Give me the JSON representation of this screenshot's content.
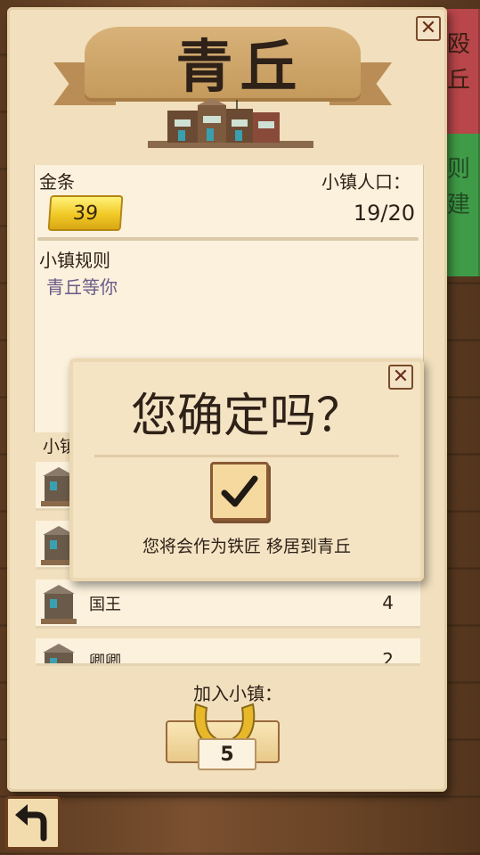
{
  "side_tabs": [
    {
      "label": "殴\n丘",
      "color": "#b8464a"
    },
    {
      "label": "则\n建",
      "color": "#3f9b47"
    }
  ],
  "town": {
    "name": "青丘",
    "gold_label": "金条",
    "gold_value": "39",
    "population_label": "小镇人口：",
    "population_value": "19/20",
    "rules_label": "小镇规则",
    "rules_text": "青丘等你",
    "list_header": "小镇"
  },
  "residents": [
    {
      "name": "",
      "count": ""
    },
    {
      "name": "",
      "count": ""
    },
    {
      "name": "国王",
      "count": "4"
    },
    {
      "name": "卿卿",
      "count": "2"
    }
  ],
  "dialog": {
    "title": "您确定吗？",
    "message": "您将会作为铁匠 移居到青丘"
  },
  "join": {
    "label": "加入小镇：",
    "price": "5"
  },
  "colors": {
    "paper": "#f1dfbd",
    "gold": "#f1c926",
    "frame": "#7a4a2a"
  }
}
